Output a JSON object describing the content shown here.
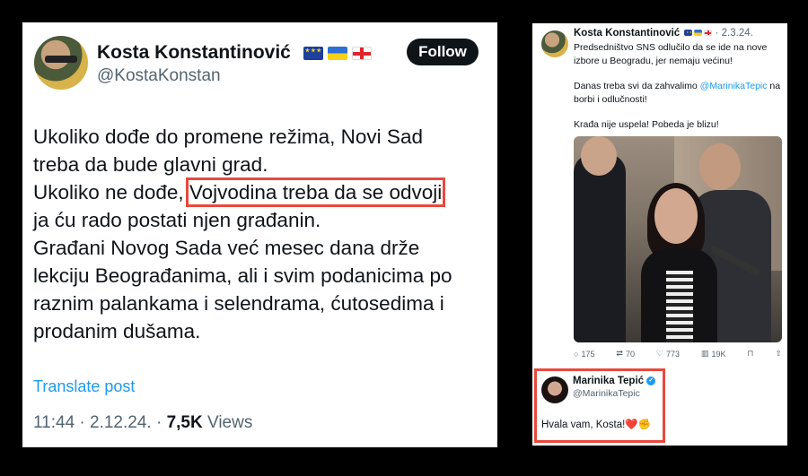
{
  "left_tweet": {
    "author_name": "Kosta Konstantinović",
    "author_handle": "@KostaKonstan",
    "flags": [
      "eu-flag",
      "ukraine-flag",
      "georgia-flag"
    ],
    "follow_label": "Follow",
    "lines": [
      {
        "pre": "Ukoliko dođe do promene režima, Novi Sad",
        "hl": "",
        "post": ""
      },
      {
        "pre": "treba da bude glavni grad.",
        "hl": "",
        "post": ""
      },
      {
        "pre": "Ukoliko ne dođe, ",
        "hl": "Vojvodina treba da se odvoji",
        "post": ""
      },
      {
        "pre": "ja ću rado postati njen građanin.",
        "hl": "",
        "post": ""
      },
      {
        "pre": "Građani Novog Sada već mesec dana drže",
        "hl": "",
        "post": ""
      },
      {
        "pre": "lekciju Beograđanima, ali i svim podanicima po",
        "hl": "",
        "post": ""
      },
      {
        "pre": "raznim palankama i selendrama, ćutosedima i",
        "hl": "",
        "post": ""
      },
      {
        "pre": "prodanim dušama.",
        "hl": "",
        "post": ""
      }
    ],
    "translate_label": "Translate post",
    "time": "11:44 · 2.12.24. · ",
    "views_count": "7,5K",
    "views_label": " Views"
  },
  "right_tweet": {
    "author_name": "Kosta Konstantinović",
    "date": "· 2.3.24.",
    "para1": "Predsedništvo SNS odlučilo da se ide na nove izbore u Beogradu, jer nemaju većinu!",
    "para2_pre": "Danas treba svi da zahvalimo ",
    "para2_mention": "@MarinikaTepic",
    "para2_post": " na borbi i odlučnosti!",
    "para3": "Krađa nije uspela! Pobeda je blizu!",
    "actions": {
      "replies": "175",
      "retweets": "70",
      "likes": "773",
      "views": "19K"
    }
  },
  "reply": {
    "name": "Marinika Tepić",
    "handle": "@MarinikaTepic",
    "text": "Hvala vam, Kosta!",
    "emoji": "❤️✊"
  },
  "colors": {
    "highlight_box": "#e8493d",
    "link_blue": "#1d9bf0",
    "secondary_text": "#536471"
  }
}
